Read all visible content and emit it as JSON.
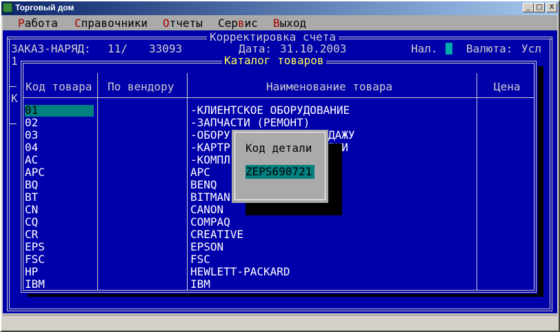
{
  "window": {
    "title": "Торговый дом",
    "minimize_glyph": "_",
    "maximize_glyph": "□",
    "close_glyph": "X"
  },
  "menu": [
    {
      "hotkey": "Р",
      "rest": "абота"
    },
    {
      "hotkey": "С",
      "rest": "правочники"
    },
    {
      "hotkey": "О",
      "rest": "тчеты"
    },
    {
      "pre": "Сер",
      "hotkey": "в",
      "rest": "ис"
    },
    {
      "hotkey": "В",
      "rest": "ыход"
    }
  ],
  "invoice": {
    "title": "Корректировка счета",
    "order_label": "ЗАКАЗ-НАРЯД:",
    "order_part1": "11/",
    "order_part2": "33093",
    "date_label": "Дата:",
    "date_value": "31.10.2003",
    "nal_label": "Нал.",
    "currency_label": "Валюта:",
    "currency_value": "Усл",
    "row2_left": "1",
    "left_k": "К"
  },
  "catalog": {
    "title": "Каталог товаров",
    "columns": [
      "Код товара",
      "По вендору",
      "Наименование товара",
      "Цена"
    ],
    "rows": [
      {
        "code": "01",
        "vendor": "",
        "name": "-КЛИЕНТСКОЕ ОБОРУДОВАНИЕ",
        "price": ""
      },
      {
        "code": "02",
        "vendor": "",
        "name": "-ЗАПЧАСТИ (РЕМОНТ)",
        "price": ""
      },
      {
        "code": "03",
        "vendor": "",
        "name": "-ОБОРУ",
        "name_tail": "ДАЖУ",
        "price": ""
      },
      {
        "code": "04",
        "vendor": "",
        "name": "-КАРТР",
        "name_tail": "РКИ",
        "price": ""
      },
      {
        "code": "AC",
        "vendor": "",
        "name": "-КОМПЛ",
        "price": ""
      },
      {
        "code": "APC",
        "vendor": "",
        "name": "APC",
        "price": ""
      },
      {
        "code": "BQ",
        "vendor": "",
        "name": "BENQ",
        "price": ""
      },
      {
        "code": "BT",
        "vendor": "",
        "name": "BITMAN",
        "price": ""
      },
      {
        "code": "CN",
        "vendor": "",
        "name": "CANON",
        "price": ""
      },
      {
        "code": "CQ",
        "vendor": "",
        "name": "COMPAQ",
        "price": ""
      },
      {
        "code": "CR",
        "vendor": "",
        "name": "CREATIVE",
        "price": ""
      },
      {
        "code": "EPS",
        "vendor": "",
        "name": "EPSON",
        "price": ""
      },
      {
        "code": "FSC",
        "vendor": "",
        "name": "FSC",
        "price": ""
      },
      {
        "code": "HP",
        "vendor": "",
        "name": "HEWLETT-PACKARD",
        "price": ""
      },
      {
        "code": "IBM",
        "vendor": "",
        "name": "IBM",
        "price": ""
      }
    ]
  },
  "dialog": {
    "label": "Код детали",
    "value": "ZEPS690721"
  },
  "colors": {
    "console_blue": "#0000aa",
    "menu_gray": "#aaaaaa",
    "hotkey_red": "#aa0000",
    "selection_teal": "#008080",
    "title_yellow": "#ffff55"
  }
}
